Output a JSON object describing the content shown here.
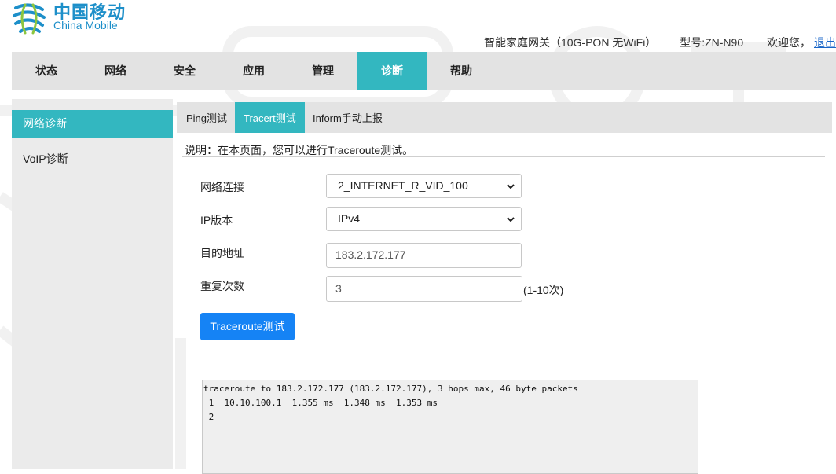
{
  "brand": {
    "name_cn": "中国移动",
    "name_en": "China Mobile",
    "color": "#1d8fc9"
  },
  "header": {
    "device": "智能家庭网关（10G-PON 无WiFi）",
    "model": "型号:ZN-N90",
    "welcome": "欢迎您，",
    "logout": "退出"
  },
  "nav": {
    "tabs": [
      "状态",
      "网络",
      "安全",
      "应用",
      "管理",
      "诊断",
      "帮助"
    ],
    "active": "诊断"
  },
  "sidebar": {
    "items": [
      "网络诊断",
      "VoIP诊断"
    ],
    "active": "网络诊断"
  },
  "subtabs": {
    "items": [
      "Ping测试",
      "Tracert测试",
      "Inform手动上报"
    ],
    "active": "Tracert测试"
  },
  "description": "说明：在本页面，您可以进行Traceroute测试。",
  "form": {
    "connection_label": "网络连接",
    "connection_value": "2_INTERNET_R_VID_100",
    "ip_version_label": "IP版本",
    "ip_version_value": "IPv4",
    "destination_label": "目的地址",
    "destination_value": "183.2.172.177",
    "repeat_label": "重复次数",
    "repeat_value": "3",
    "repeat_hint": "(1-10次)",
    "submit_label": "Traceroute测试"
  },
  "result": {
    "lines": [
      "traceroute to 183.2.172.177 (183.2.172.177), 3 hops max, 46 byte packets",
      " 1  10.10.100.1  1.355 ms  1.348 ms  1.353 ms",
      " 2"
    ]
  },
  "colors": {
    "accent": "#33b7c0",
    "button": "#1583f5",
    "nav_bg": "#e3e3e3",
    "sidebar_bg": "#ebebeb"
  }
}
